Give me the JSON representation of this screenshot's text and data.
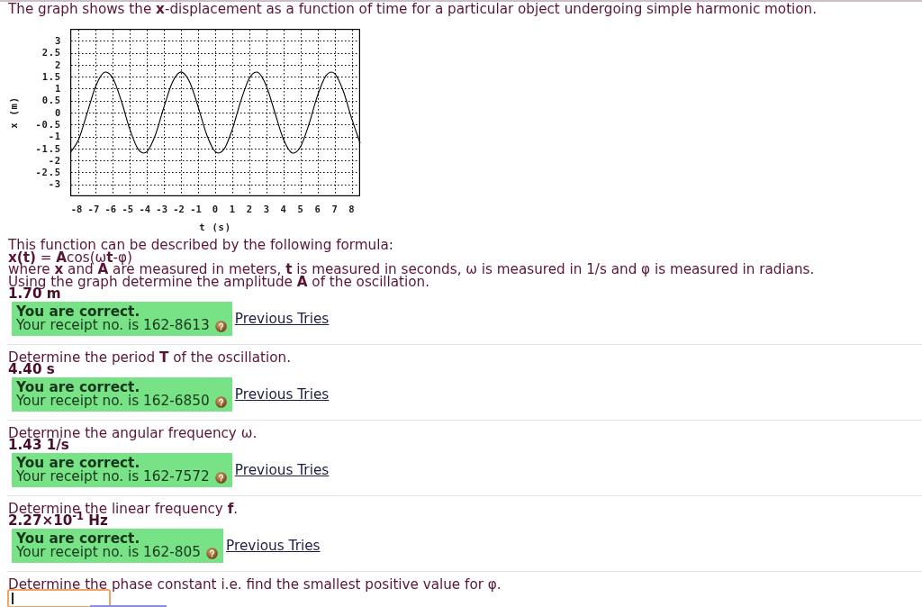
{
  "intro": "The graph shows the **x**-displacement as a function of time for a particular object undergoing simple harmonic motion.",
  "chart": {
    "chart_data": {
      "type": "line",
      "grid": true,
      "xlabel": "t (s)",
      "ylabel": "x (m)",
      "x": [
        -8.5,
        -8,
        -7.5,
        -7,
        -6.5,
        -6,
        -5.5,
        -5,
        -4.5,
        -4,
        -3.5,
        -3,
        -2.5,
        -2,
        -1.5,
        -1,
        -0.5,
        0,
        0.5,
        1,
        1.5,
        2,
        2.5,
        3,
        3.5,
        4,
        4.5,
        5,
        5.5,
        6,
        6.5,
        7,
        7.5,
        8,
        8.5
      ],
      "series": [
        {
          "color": "#000000",
          "values": [
            -1.68,
            -1.11,
            0,
            1.11,
            1.68,
            1.43,
            0.48,
            -0.71,
            -1.55,
            -1.63,
            -0.92,
            0.24,
            1.28,
            1.7,
            1.28,
            0.24,
            -0.92,
            -1.63,
            -1.55,
            -0.71,
            0.48,
            1.43,
            1.68,
            1.11,
            0,
            -1.11,
            -1.68,
            -1.43,
            -0.48,
            0.71,
            1.55,
            1.63,
            0.92,
            -0.24,
            -1.28
          ]
        }
      ],
      "xlim": [
        -8.5,
        8.5
      ],
      "ylim": [
        -3.5,
        3.5
      ],
      "xticks": [
        -8,
        -7,
        -6,
        -5,
        -4,
        -3,
        -2,
        -1,
        0,
        1,
        2,
        3,
        4,
        5,
        6,
        7,
        8
      ],
      "yticks": [
        3,
        2.5,
        2,
        1.5,
        1,
        0.5,
        0,
        -0.5,
        -1,
        -1.5,
        -2,
        -2.5,
        -3
      ]
    }
  },
  "parts": [
    {
      "kind": "answered",
      "lines": [
        "This function can be described by the following formula:",
        "**x(t)** = **A**cos(ω**t**-φ)",
        "where **x** and **A** are measured in meters, **t** is measured in seconds, ω is measured in 1/s and φ is measured in radians.",
        "Using the graph determine the amplitude **A** of the oscillation."
      ],
      "answer": "1.70 m",
      "feedback": {
        "correct": true,
        "title": "You are correct.",
        "receipt": "Your receipt no. is 162-8613"
      },
      "link": "Previous Tries"
    },
    {
      "kind": "answered",
      "lines": [
        "Determine the period **T** of the oscillation."
      ],
      "answer": "4.40 s",
      "feedback": {
        "correct": true,
        "title": "You are correct.",
        "receipt": "Your receipt no. is 162-6850"
      },
      "link": "Previous Tries"
    },
    {
      "kind": "answered",
      "lines": [
        "Determine the angular frequency ω."
      ],
      "answer": "1.43 1/s",
      "feedback": {
        "correct": true,
        "title": "You are correct.",
        "receipt": "Your receipt no. is 162-7572"
      },
      "link": "Previous Tries"
    },
    {
      "kind": "answered",
      "lines": [
        "Determine the linear frequency **f**."
      ],
      "answer": "2.27×10$^{-1}$ Hz",
      "feedback": {
        "correct": true,
        "title": "You are correct.",
        "receipt": "Your receipt no. is 162-805"
      },
      "link": "Previous Tries"
    },
    {
      "kind": "open",
      "lines": [
        "Determine the phase constant i.e. find the smallest positive value for φ."
      ]
    }
  ]
}
